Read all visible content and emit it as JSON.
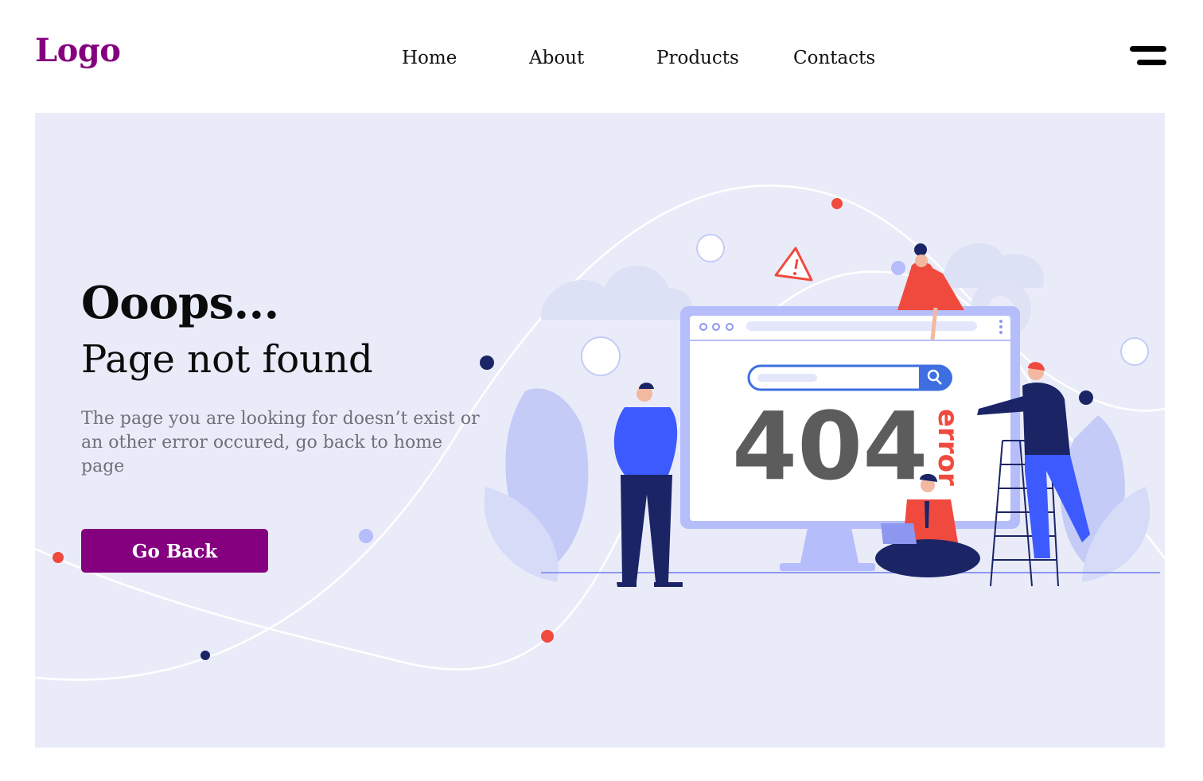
{
  "header": {
    "logo": "Logo",
    "nav": [
      {
        "label": "Home"
      },
      {
        "label": "About"
      },
      {
        "label": "Products"
      },
      {
        "label": "Contacts"
      }
    ]
  },
  "hero": {
    "title": "Ooops...",
    "subtitle": "Page not found",
    "description": "The page you are looking for doesn’t exist or an other error occured, go back to home page",
    "button_label": "Go Back"
  },
  "illustration": {
    "code": "404",
    "error_word": "error"
  },
  "colors": {
    "brand": "#84007f",
    "hero_bg": "#e9ecf8",
    "accent_red": "#f04a3f",
    "navy": "#1b2566",
    "periwinkle": "#b5bdfa"
  }
}
